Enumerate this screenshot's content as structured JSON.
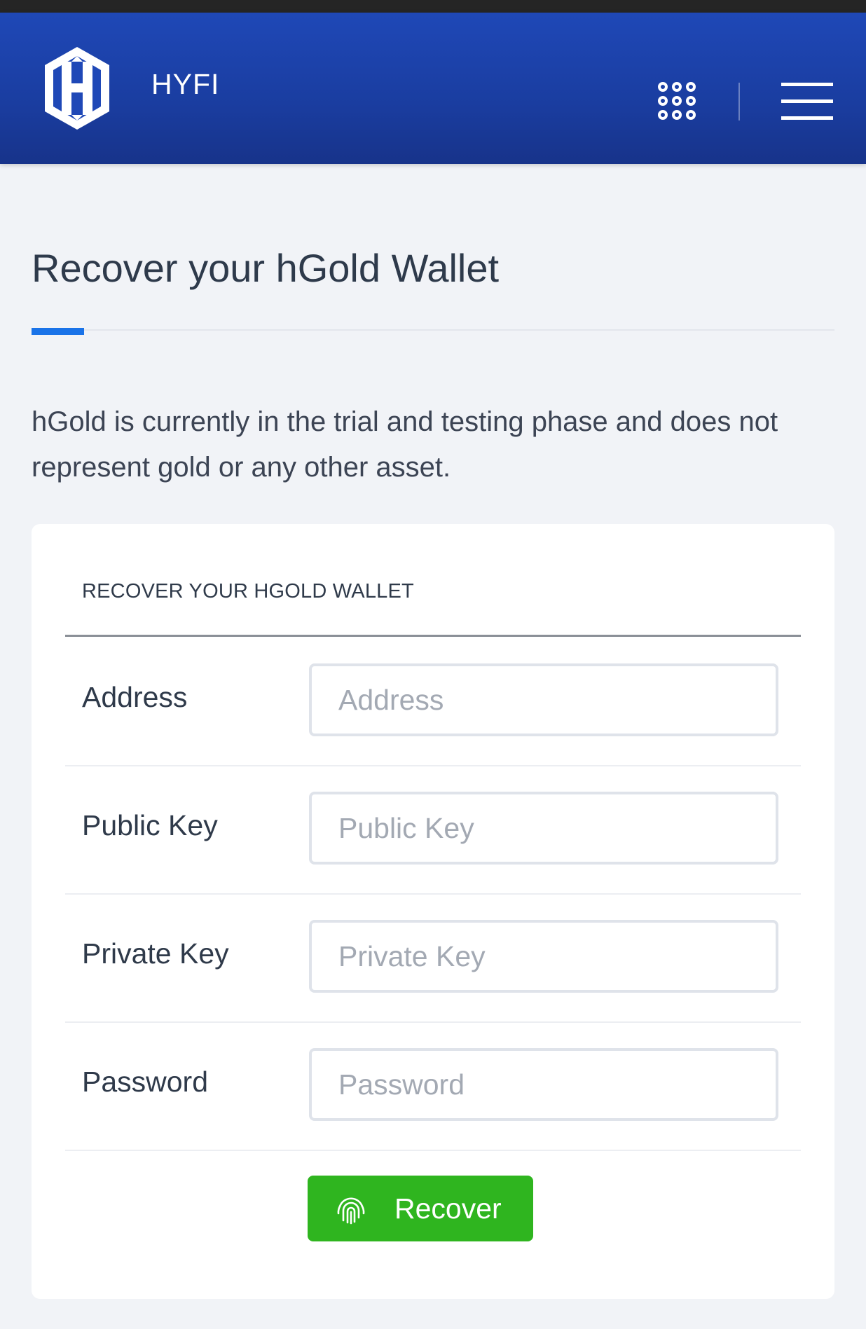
{
  "header": {
    "brand": "HYFI",
    "logo_icon": "hyfi-hexagon-logo",
    "apps_icon": "grid-dots-icon",
    "menu_icon": "hamburger-menu-icon",
    "background_color": "#1f48b7"
  },
  "page": {
    "title": "Recover your hGold Wallet",
    "accent_color": "#1a73e8",
    "intro": "hGold is currently in the trial and testing phase and does not represent gold or any other asset."
  },
  "card": {
    "header": "RECOVER YOUR HGOLD WALLET",
    "fields": [
      {
        "label": "Address",
        "placeholder": "Address",
        "value": ""
      },
      {
        "label": "Public Key",
        "placeholder": "Public Key",
        "value": ""
      },
      {
        "label": "Private Key",
        "placeholder": "Private Key",
        "value": ""
      },
      {
        "label": "Password",
        "placeholder": "Password",
        "value": ""
      }
    ],
    "submit": {
      "label": "Recover",
      "icon": "fingerprint-icon",
      "color": "#2fb51f"
    }
  }
}
